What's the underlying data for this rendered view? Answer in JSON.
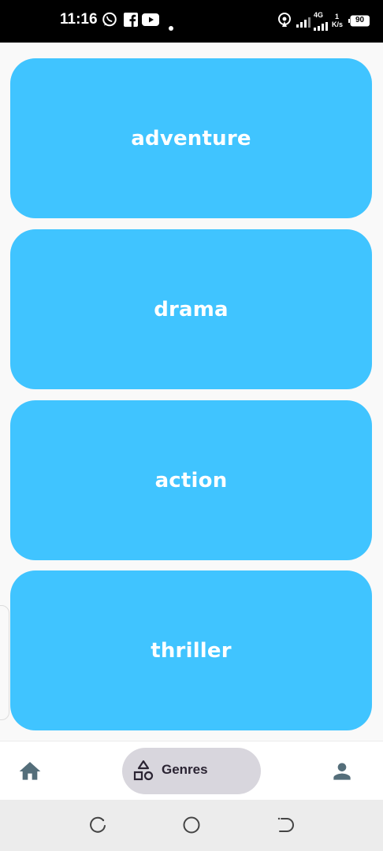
{
  "status_bar": {
    "time": "11:16",
    "network_top": "4G",
    "speed_value": "1",
    "speed_unit": "K/s",
    "battery": "90",
    "icons": [
      "whatsapp-icon",
      "facebook-icon",
      "youtube-icon",
      "notification-dot-icon",
      "hotspot-icon",
      "signal-icon",
      "signal-4g-icon",
      "battery-icon"
    ]
  },
  "genres": {
    "items": [
      {
        "label": "adventure"
      },
      {
        "label": "drama"
      },
      {
        "label": "action"
      },
      {
        "label": "thriller"
      }
    ],
    "card_color": "#40c4ff"
  },
  "bottom_nav": {
    "items": [
      {
        "icon": "home-icon",
        "label": ""
      },
      {
        "icon": "shapes-icon",
        "label": "Genres",
        "active": true
      },
      {
        "icon": "person-icon",
        "label": ""
      }
    ],
    "active_pill_color": "#d8d6dd",
    "icon_color": "#546e7a"
  },
  "system_nav": {
    "icons": [
      "recent-apps-icon",
      "home-circle-icon",
      "back-icon"
    ]
  }
}
